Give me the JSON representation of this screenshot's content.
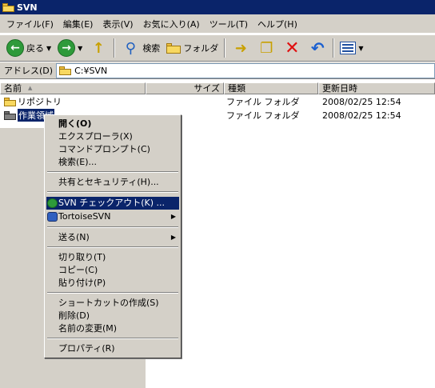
{
  "window": {
    "title": "SVN"
  },
  "menubar": [
    "ファイル(F)",
    "編集(E)",
    "表示(V)",
    "お気に入り(A)",
    "ツール(T)",
    "ヘルプ(H)"
  ],
  "toolbar": {
    "back_label": "戻る",
    "search_label": "検索",
    "folders_label": "フォルダ"
  },
  "address": {
    "label": "アドレス(D)",
    "value": "C:¥SVN"
  },
  "columns": {
    "name": "名前",
    "size": "サイズ",
    "type": "種類",
    "date": "更新日時"
  },
  "files": [
    {
      "name": "リポジトリ",
      "type": "ファイル フォルダ",
      "date": "2008/02/25 12:54"
    },
    {
      "name": "作業領域",
      "type": "ファイル フォルダ",
      "date": "2008/02/25 12:54"
    }
  ],
  "context_menu": {
    "open": "開く(O)",
    "explorer": "エクスプローラ(X)",
    "cmd": "コマンドプロンプト(C)",
    "search": "検索(E)...",
    "share": "共有とセキュリティ(H)...",
    "svn_checkout": "SVN チェックアウト(K) ...",
    "tortoise": "TortoiseSVN",
    "sendto": "送る(N)",
    "cut": "切り取り(T)",
    "copy": "コピー(C)",
    "paste": "貼り付け(P)",
    "shortcut": "ショートカットの作成(S)",
    "delete": "削除(D)",
    "rename": "名前の変更(M)",
    "properties": "プロパティ(R)"
  }
}
